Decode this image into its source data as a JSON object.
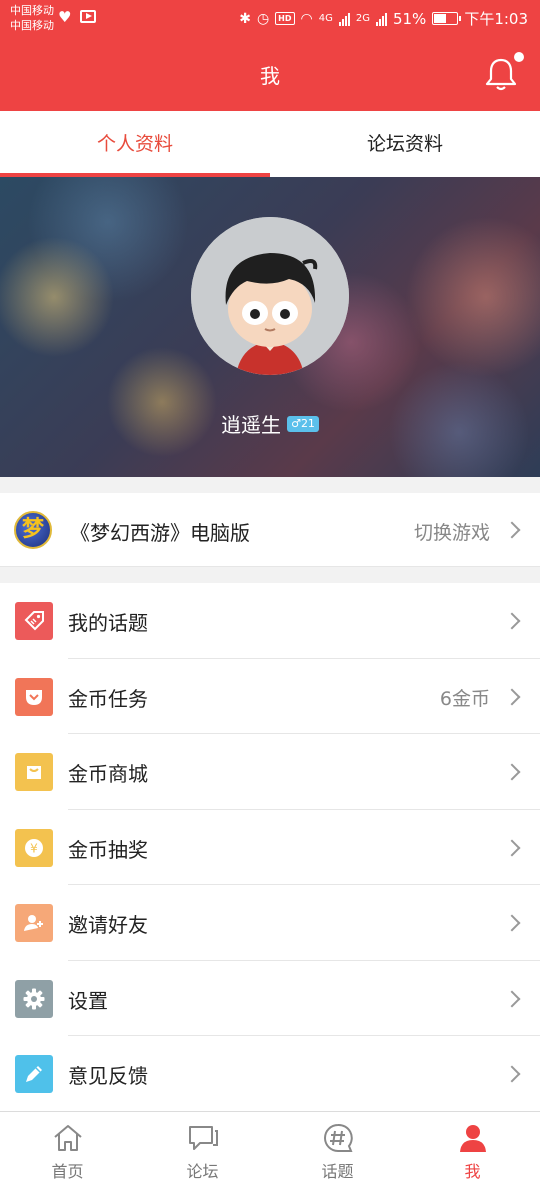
{
  "status_bar": {
    "carrier_1": "中国移动",
    "carrier_2": "中国移动",
    "hd_badge": "HD",
    "net_4g": "4G",
    "net_2g": "2G",
    "battery": "51%",
    "time": "下午1:03"
  },
  "header": {
    "title": "我"
  },
  "tabs": [
    {
      "label": "个人资料",
      "active": true
    },
    {
      "label": "论坛资料",
      "active": false
    }
  ],
  "profile": {
    "username": "逍遥生",
    "gender_symbol": "♂",
    "level": "21"
  },
  "game": {
    "logo_text": "梦",
    "name": "《梦幻西游》电脑版",
    "switch_label": "切换游戏"
  },
  "menu": [
    {
      "label": "我的话题",
      "value": "",
      "icon": "tag-icon",
      "color": "#ec5a5a"
    },
    {
      "label": "金币任务",
      "value": "6金币",
      "icon": "task-pocket-icon",
      "color": "#f17558"
    },
    {
      "label": "金币商城",
      "value": "",
      "icon": "shopping-bag-icon",
      "color": "#f3c24f"
    },
    {
      "label": "金币抽奖",
      "value": "",
      "icon": "coin-lottery-icon",
      "color": "#f3c24f"
    },
    {
      "label": "邀请好友",
      "value": "",
      "icon": "invite-friend-icon",
      "color": "#f6a878"
    },
    {
      "label": "设置",
      "value": "",
      "icon": "gear-icon",
      "color": "#8fa0a6"
    },
    {
      "label": "意见反馈",
      "value": "",
      "icon": "pencil-icon",
      "color": "#4fc1ea"
    }
  ],
  "bottom_nav": [
    {
      "label": "首页",
      "icon": "home-icon",
      "active": false
    },
    {
      "label": "论坛",
      "icon": "forum-chat-icon",
      "active": false
    },
    {
      "label": "话题",
      "icon": "hashtag-icon",
      "active": false
    },
    {
      "label": "我",
      "icon": "person-icon",
      "active": true
    }
  ],
  "colors": {
    "brand_red": "#ee4343",
    "accent_text": "#e84b3c",
    "badge_blue": "#5bc0eb"
  }
}
